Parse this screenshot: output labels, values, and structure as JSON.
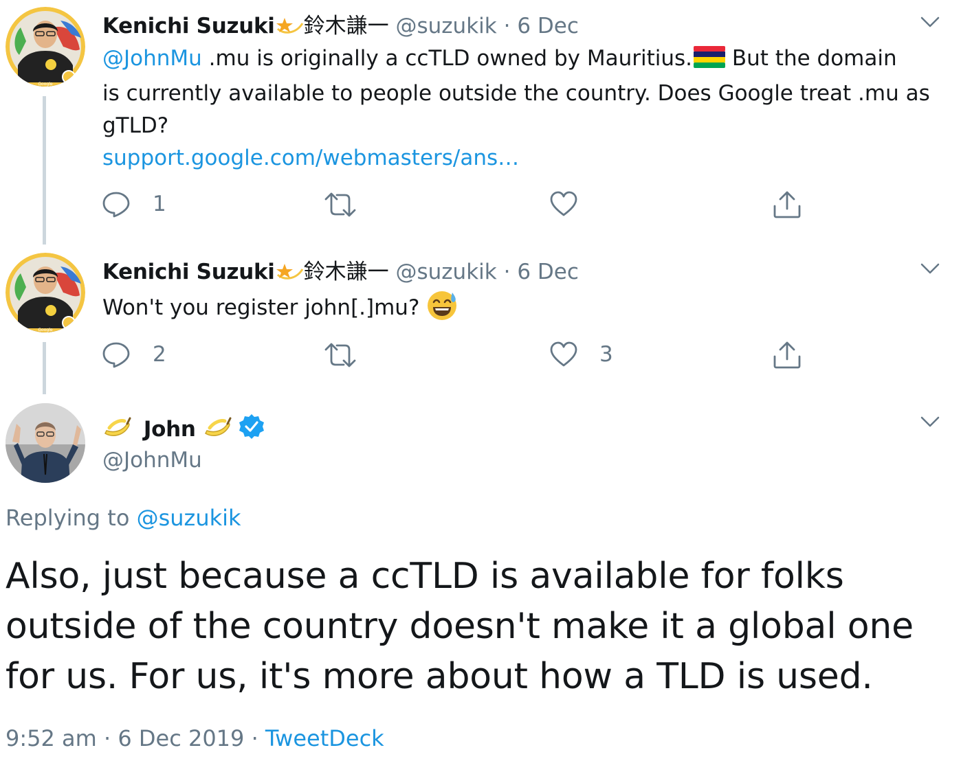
{
  "tweets": [
    {
      "author_name": "Kenichi Suzuki",
      "author_suffix": "鈴木謙一",
      "handle": "@suzukik",
      "separator": "·",
      "date": "6 Dec",
      "mention": "@JohnMu",
      "text_line1": " .mu is originally a ccTLD owned by Mauritius.",
      "text_after_flag": " But the domain",
      "text_rest": "is currently available to people outside the country. Does Google treat .mu as gTLD?",
      "link": "support.google.com/webmasters/ans…",
      "reply_count": "1",
      "retweet_count": "",
      "like_count": ""
    },
    {
      "author_name": "Kenichi Suzuki",
      "author_suffix": "鈴木謙一",
      "handle": "@suzukik",
      "separator": "·",
      "date": "6 Dec",
      "text": "Won't you register john[.]mu? ",
      "reply_count": "2",
      "retweet_count": "",
      "like_count": "3"
    }
  ],
  "main_tweet": {
    "author_name": "John",
    "handle": "@JohnMu",
    "replying_label": "Replying to ",
    "replying_handle": "@suzukik",
    "text": "Also, just because a ccTLD is available for folks outside of the country doesn't make it a global one for us. For us, it's more about how a TLD is used.",
    "time": "9:52 am",
    "separator": "·",
    "date": "6 Dec 2019",
    "source": "TweetDeck"
  },
  "colors": {
    "link": "#1b95e0",
    "muted": "#657786",
    "icon": "#657786",
    "verified": "#1da1f2",
    "thread_line": "#ccd6dd"
  },
  "icons": [
    "reply-icon",
    "retweet-icon",
    "like-icon",
    "share-icon",
    "chevron-down-icon",
    "verified-badge-icon",
    "banana-icon",
    "star-icon",
    "mauritius-flag-icon",
    "sweat-smile-emoji"
  ]
}
